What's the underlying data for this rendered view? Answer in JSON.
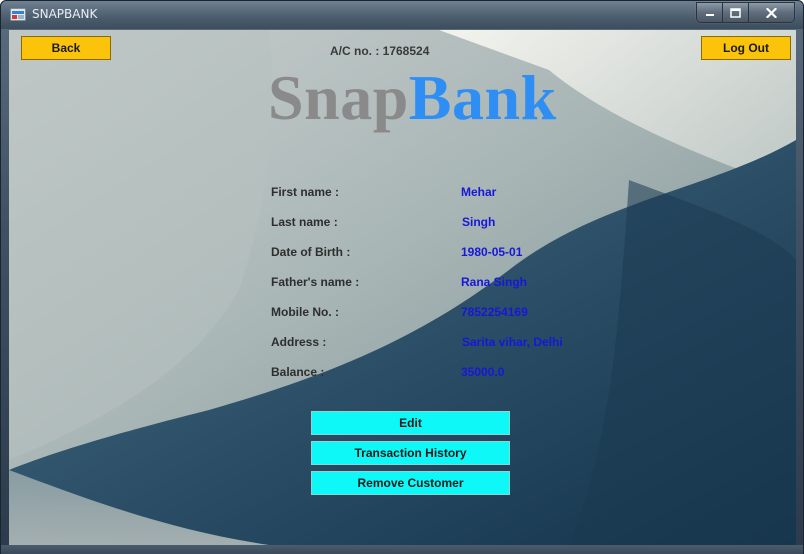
{
  "window": {
    "title": "SNAPBANK",
    "controls": {
      "minimize": "minimize",
      "maximize": "maximize",
      "close": "close"
    }
  },
  "header": {
    "back_label": "Back",
    "logout_label": "Log Out",
    "account_label": "A/C no. : 1768524"
  },
  "logo": {
    "part1": "Snap",
    "part2": "Bank",
    "colors": {
      "part1": "#8a8a8a",
      "part2": "#2f8ef3"
    }
  },
  "customer": {
    "fields": [
      {
        "label": "First name :",
        "value": "Mehar"
      },
      {
        "label": "Last name :",
        "value": "Singh"
      },
      {
        "label": "Date of Birth :",
        "value": "1980-05-01"
      },
      {
        "label": "Father's name :",
        "value": "Rana Singh"
      },
      {
        "label": "Mobile No. :",
        "value": "7852254169"
      },
      {
        "label": "Address :",
        "value": "Sarita vihar, Delhi"
      },
      {
        "label": "Balance :",
        "value": "35000.0"
      }
    ]
  },
  "actions": {
    "edit_label": "Edit",
    "history_label": "Transaction History",
    "remove_label": "Remove Customer"
  },
  "colors": {
    "accent_yellow": "#fbc30a",
    "accent_cyan": "#0ff8f8",
    "value_text": "#1717d9"
  }
}
